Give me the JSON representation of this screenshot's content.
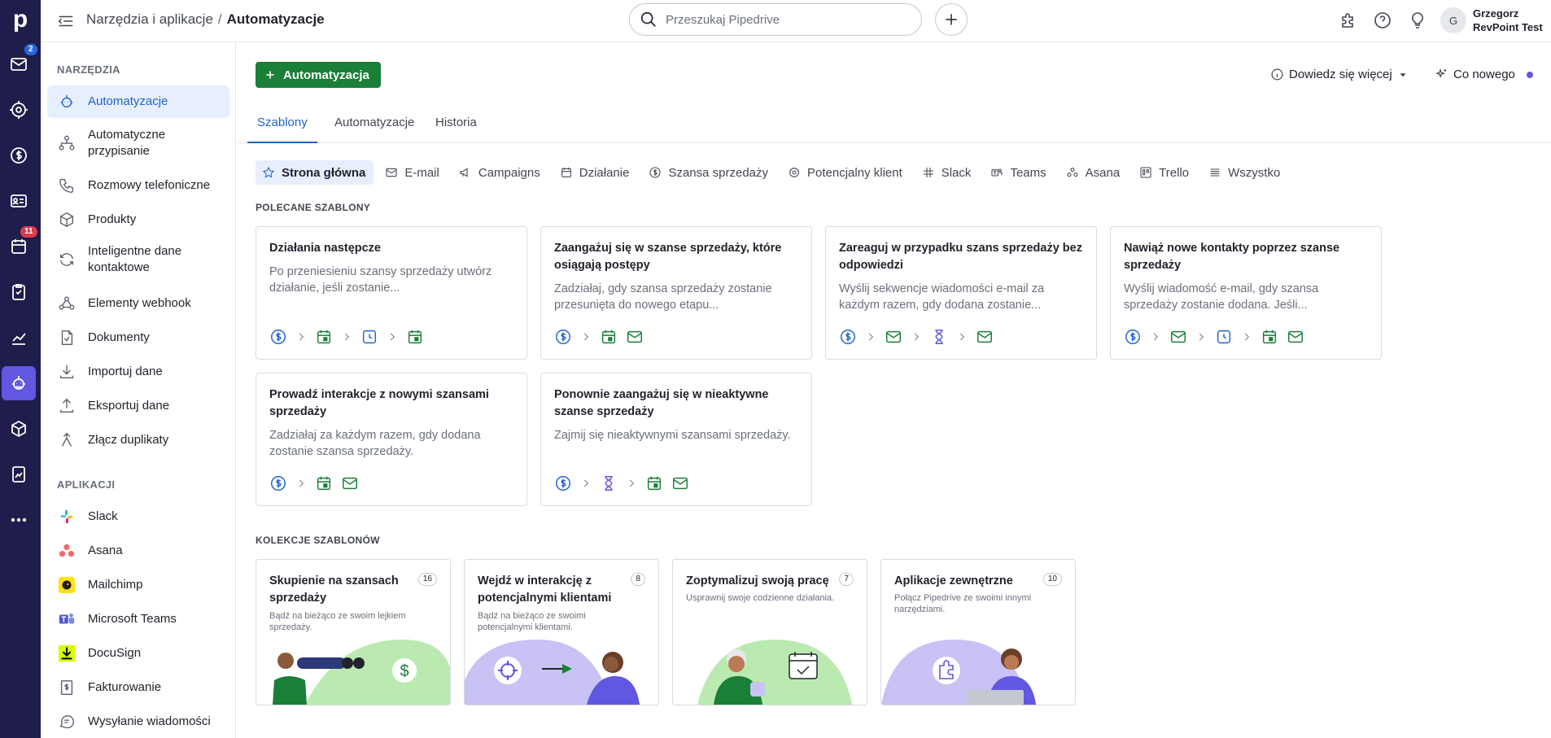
{
  "rail": {
    "logo": "p",
    "mail_badge": "2",
    "calendar_badge": "11"
  },
  "topbar": {
    "breadcrumb_parent": "Narzędzia i aplikacje",
    "breadcrumb_separator": "/",
    "breadcrumb_current": "Automatyzacje",
    "search_placeholder": "Przeszukaj Pipedrive",
    "avatar_initial": "G",
    "user_name": "Grzegorz",
    "user_company": "RevPoint Test"
  },
  "sidebar": {
    "tools_title": "NARZĘDZIA",
    "tools": [
      {
        "label": "Automatyzacje",
        "icon": "robot-icon"
      },
      {
        "label": "Automatyczne przypisanie",
        "icon": "assignment-icon"
      },
      {
        "label": "Rozmowy telefoniczne",
        "icon": "phone-icon"
      },
      {
        "label": "Produkty",
        "icon": "box-icon"
      },
      {
        "label": "Inteligentne dane kontaktowe",
        "icon": "sync-icon"
      },
      {
        "label": "Elementy webhook",
        "icon": "webhook-icon"
      },
      {
        "label": "Dokumenty",
        "icon": "document-icon"
      },
      {
        "label": "Importuj dane",
        "icon": "import-icon"
      },
      {
        "label": "Eksportuj dane",
        "icon": "export-icon"
      },
      {
        "label": "Złącz duplikaty",
        "icon": "merge-icon"
      }
    ],
    "apps_title": "APLIKACJI",
    "apps": [
      {
        "label": "Slack",
        "icon": "slack-icon"
      },
      {
        "label": "Asana",
        "icon": "asana-icon"
      },
      {
        "label": "Mailchimp",
        "icon": "mailchimp-icon"
      },
      {
        "label": "Microsoft Teams",
        "icon": "teams-icon"
      },
      {
        "label": "DocuSign",
        "icon": "docusign-icon"
      },
      {
        "label": "Fakturowanie",
        "icon": "invoice-icon"
      },
      {
        "label": "Wysyłanie wiadomości",
        "icon": "message-icon"
      }
    ]
  },
  "main": {
    "primary_button": "Automatyzacja",
    "learn_more": "Dowiedz się więcej",
    "whats_new": "Co nowego",
    "tabs": [
      "Szablony",
      "Automatyzacje",
      "Historia"
    ],
    "chips": [
      {
        "label": "Strona główna",
        "icon": "star-icon"
      },
      {
        "label": "E-mail",
        "icon": "mail-icon"
      },
      {
        "label": "Campaigns",
        "icon": "megaphone-icon"
      },
      {
        "label": "Działanie",
        "icon": "calendar-icon"
      },
      {
        "label": "Szansa sprzedaży",
        "icon": "dollar-icon"
      },
      {
        "label": "Potencjalny klient",
        "icon": "target-icon"
      },
      {
        "label": "Slack",
        "icon": "slack-icon"
      },
      {
        "label": "Teams",
        "icon": "teams-icon"
      },
      {
        "label": "Asana",
        "icon": "asana-icon"
      },
      {
        "label": "Trello",
        "icon": "trello-icon"
      },
      {
        "label": "Wszystko",
        "icon": "list-icon"
      }
    ],
    "recommended_title": "POLECANE SZABLONY",
    "templates": [
      {
        "title": "Działania następcze",
        "desc": "Po przeniesieniu szansy sprzedaży utwórz działanie, jeśli zostanie..."
      },
      {
        "title": "Zaangażuj się w szanse sprzedaży, które osiągają postępy",
        "desc": "Zadziałaj, gdy szansa sprzedaży zostanie przesunięta do nowego etapu..."
      },
      {
        "title": "Zareaguj w przypadku szans sprzedaży bez odpowiedzi",
        "desc": "Wyślij sekwencje wiadomości e-mail za każdym razem, gdy dodana zostanie..."
      },
      {
        "title": "Nawiąż nowe kontakty poprzez szanse sprzedaży",
        "desc": "Wyślij wiadomość e-mail, gdy szansa sprzedaży zostanie dodana. Jeśli..."
      },
      {
        "title": "Prowadź interakcje z nowymi szansami sprzedaży",
        "desc": "Zadziałaj za każdym razem, gdy dodana zostanie szansa sprzedaży."
      },
      {
        "title": "Ponownie zaangażuj się w nieaktywne szanse sprzedaży",
        "desc": "Zajmij się nieaktywnymi szansami sprzedaży."
      }
    ],
    "collections_title": "KOLEKCJE SZABLONÓW",
    "collections": [
      {
        "title": "Skupienie na szansach sprzedaży",
        "count": "16",
        "desc": "Bądź na bieżąco ze swoim lejkiem sprzedaży."
      },
      {
        "title": "Wejdź w interakcję z potencjalnymi klientami",
        "count": "8",
        "desc": "Bądź na bieżąco ze swoimi potencjalnymi klientami."
      },
      {
        "title": "Zoptymalizuj swoją pracę",
        "count": "7",
        "desc": "Usprawnij swoje codzienne działania."
      },
      {
        "title": "Aplikacje zewnętrzne",
        "count": "10",
        "desc": "Połącz Pipedrive ze swoimi innymi narzędziami."
      }
    ]
  },
  "colors": {
    "rail_bg": "#1e1d4b",
    "accent_blue": "#2062d0",
    "primary_green": "#1a7f37",
    "active_rail": "#6157e0"
  }
}
